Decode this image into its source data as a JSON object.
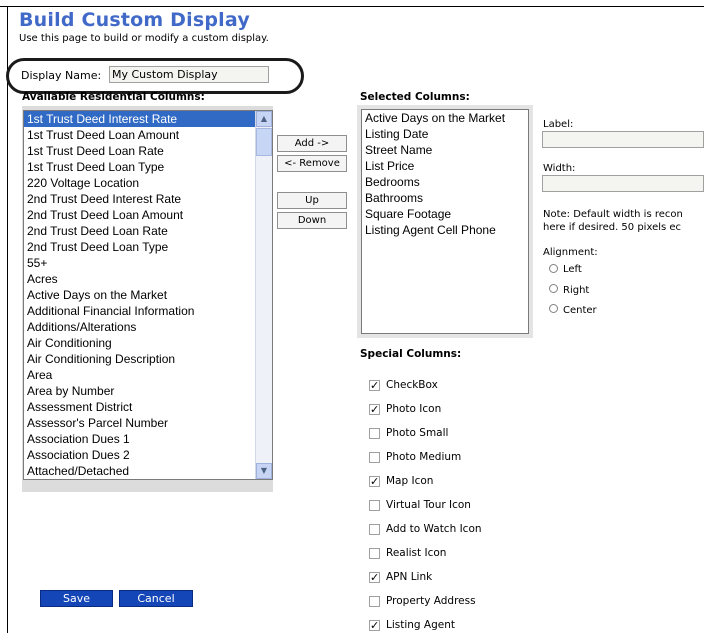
{
  "page": {
    "title": "Build Custom Display",
    "subtitle": "Use this page to build or modify a custom display."
  },
  "display_name": {
    "label": "Display Name:",
    "value": "My Custom Display"
  },
  "available": {
    "label": "Available Residential Columns:",
    "items": [
      "1st Trust Deed Interest Rate",
      "1st Trust Deed Loan Amount",
      "1st Trust Deed Loan Rate",
      "1st Trust Deed Loan Type",
      "220 Voltage Location",
      "2nd Trust Deed Interest Rate",
      "2nd Trust Deed Loan Amount",
      "2nd Trust Deed Loan Rate",
      "2nd Trust Deed Loan Type",
      "55+",
      "Acres",
      "Active Days on the Market",
      "Additional Financial Information",
      "Additions/Alterations",
      "Air Conditioning",
      "Air Conditioning Description",
      "Area",
      "Area by Number",
      "Assessment District",
      "Assessor's Parcel Number",
      "Association Dues 1",
      "Association Dues 2",
      "Attached/Detached"
    ]
  },
  "buttons": {
    "add": "Add ->",
    "remove": "<- Remove",
    "up": "Up",
    "down": "Down",
    "save": "Save",
    "cancel": "Cancel"
  },
  "selected": {
    "label": "Selected Columns:",
    "items": [
      "Active Days on the Market",
      "Listing Date",
      "Street Name",
      "List Price",
      "Bedrooms",
      "Bathrooms",
      "Square Footage",
      "Listing Agent Cell Phone"
    ]
  },
  "props": {
    "label_label": "Label:",
    "width_label": "Width:",
    "note_line1": "Note: Default width is recon",
    "note_line2": "here if desired. 50 pixels ec",
    "alignment_label": "Alignment:",
    "left": "Left",
    "right": "Right",
    "center": "Center"
  },
  "special": {
    "label": "Special Columns:",
    "items": [
      {
        "label": "CheckBox",
        "checked": true
      },
      {
        "label": "Photo Icon",
        "checked": true
      },
      {
        "label": "Photo Small",
        "checked": false
      },
      {
        "label": "Photo Medium",
        "checked": false
      },
      {
        "label": "Map Icon",
        "checked": true
      },
      {
        "label": "Virtual Tour Icon",
        "checked": false
      },
      {
        "label": "Add to Watch Icon",
        "checked": false
      },
      {
        "label": "Realist Icon",
        "checked": false
      },
      {
        "label": "APN Link",
        "checked": true
      },
      {
        "label": "Property Address",
        "checked": false
      },
      {
        "label": "Listing Agent",
        "checked": true
      }
    ]
  },
  "colors": {
    "title": "#4169c8",
    "selection": "#316ac5",
    "action_button": "#1446b8"
  }
}
